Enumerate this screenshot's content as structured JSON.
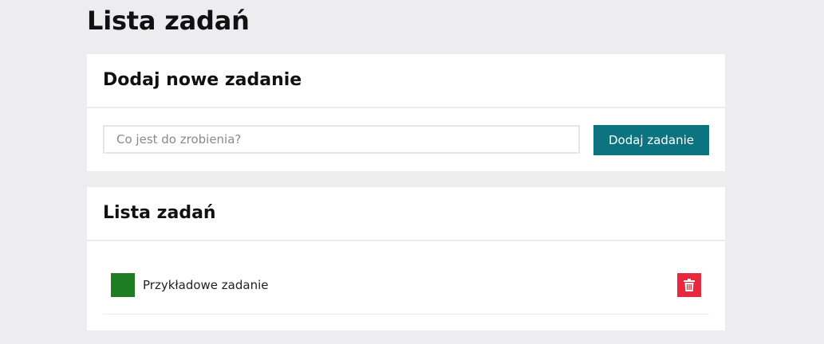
{
  "page": {
    "title": "Lista zadań"
  },
  "add_card": {
    "title": "Dodaj nowe zadanie",
    "input_placeholder": "Co jest do zrobienia?",
    "input_value": "",
    "button_label": "Dodaj zadanie"
  },
  "list_card": {
    "title": "Lista zadań",
    "tasks": [
      {
        "label": "Przykładowe zadanie",
        "checkbox_color": "#1e7d23",
        "delete_icon": "trash-icon"
      }
    ]
  },
  "colors": {
    "background": "#ededef",
    "accent": "#0b7480",
    "danger": "#e8283f",
    "done": "#1e7d23"
  }
}
